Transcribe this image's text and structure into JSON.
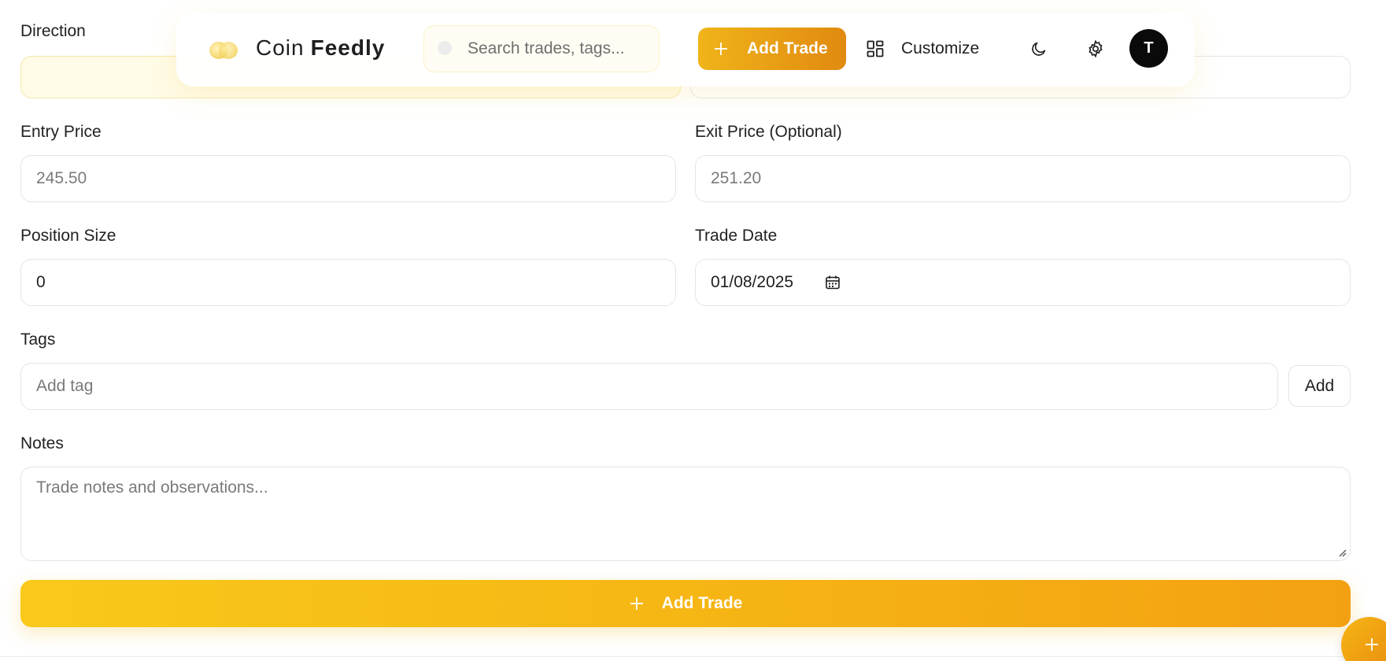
{
  "header": {
    "logo_word_1": "Coin",
    "logo_word_2": "Feedly",
    "search_placeholder": "Search trades, tags...",
    "add_trade_label": "Add Trade",
    "customize_label": "Customize",
    "avatar_initial": "T"
  },
  "form": {
    "direction_label": "Direction",
    "entry_price_label": "Entry Price",
    "entry_price_placeholder": "245.50",
    "exit_price_label": "Exit Price (Optional)",
    "exit_price_placeholder": "251.20",
    "position_size_label": "Position Size",
    "position_size_value": "0",
    "trade_date_label": "Trade Date",
    "trade_date_value": "01/08/2025",
    "tags_label": "Tags",
    "tags_placeholder": "Add tag",
    "add_tag_label": "Add",
    "notes_label": "Notes",
    "notes_placeholder": "Trade notes and observations...",
    "submit_label": "Add Trade"
  },
  "icons": {
    "logo": "coin-logo-icon",
    "search": "search-icon",
    "add": "plus-icon",
    "customize": "grid-icon",
    "theme": "moon-icon",
    "settings": "gear-icon",
    "calendar": "calendar-icon"
  },
  "colors": {
    "accent": "#f6b614",
    "accent_dark": "#e18a10",
    "highlight_bg": "#fffbe6",
    "avatar_bg": "#0a0a0a"
  }
}
